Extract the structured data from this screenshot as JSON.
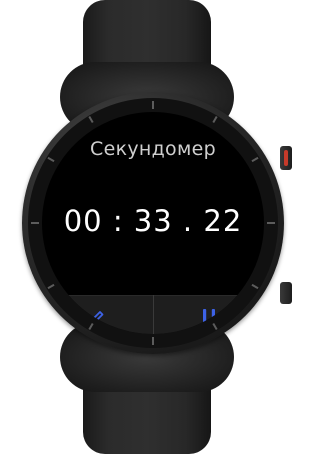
{
  "stopwatch": {
    "title": "Секундомер",
    "elapsed": "00 : 33 . 22"
  },
  "controls": {
    "lap_icon": "pencil-lap-icon",
    "pause_icon": "pause-icon",
    "accent_color": "#3d62e6"
  },
  "device": {
    "crown_accent": "#c63a2a"
  }
}
